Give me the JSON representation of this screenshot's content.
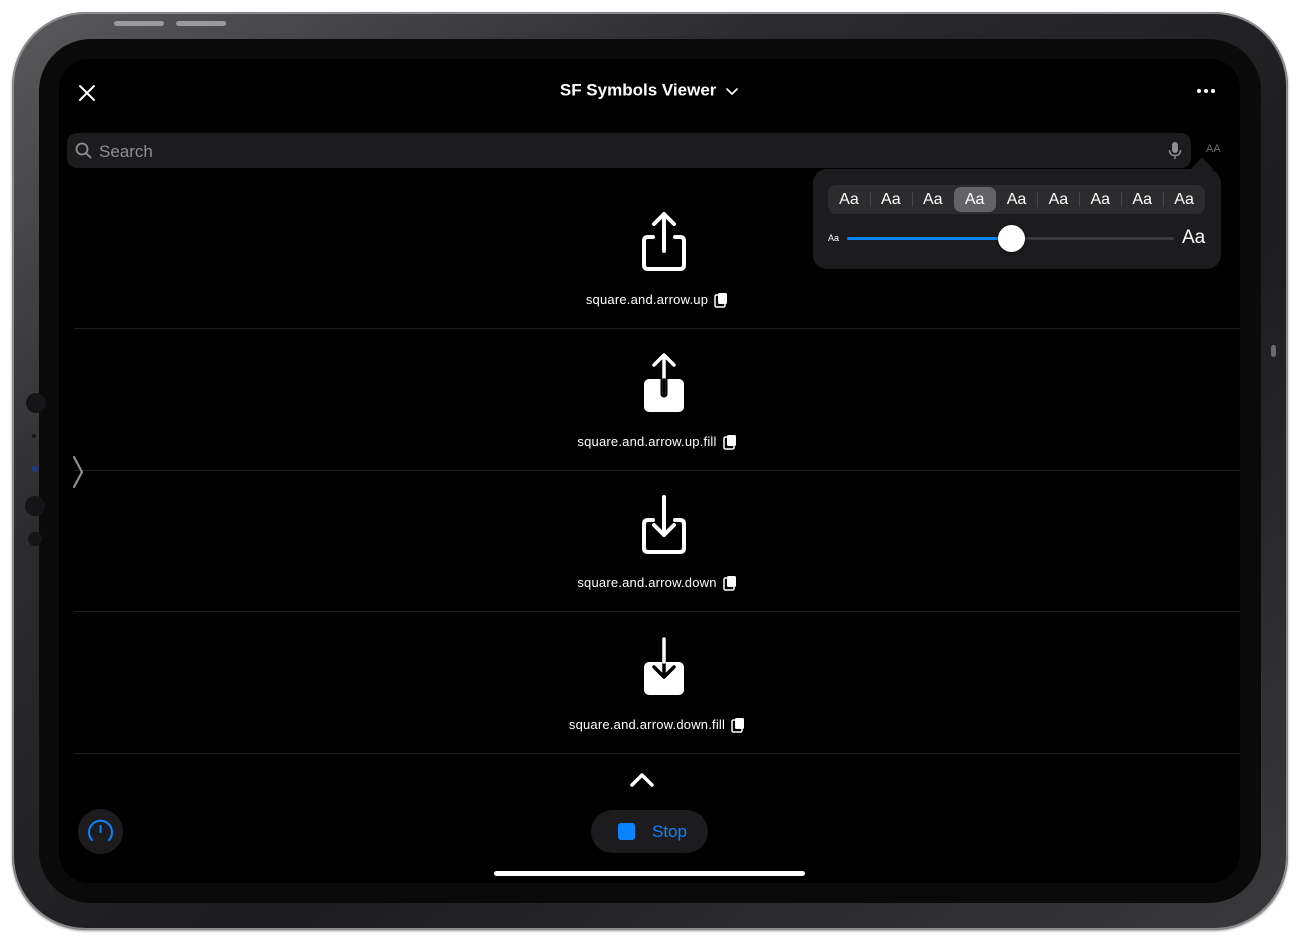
{
  "nav": {
    "title": "SF Symbols Viewer",
    "close_icon": "xmark-icon",
    "more_icon": "ellipsis-icon",
    "title_chevron_icon": "chevron-down-icon"
  },
  "search": {
    "placeholder": "Search",
    "value": "",
    "text_size_label": "AA"
  },
  "text_size_popover": {
    "options": [
      "Aa",
      "Aa",
      "Aa",
      "Aa",
      "Aa",
      "Aa",
      "Aa",
      "Aa",
      "Aa"
    ],
    "selected_index": 3,
    "slider_min_label": "Aa",
    "slider_max_label": "Aa",
    "slider_value": 0.5
  },
  "symbols": [
    {
      "name": "square.and.arrow.up",
      "icon": "square-and-arrow-up-icon"
    },
    {
      "name": "square.and.arrow.up.fill",
      "icon": "square-and-arrow-up-fill-icon"
    },
    {
      "name": "square.and.arrow.down",
      "icon": "square-and-arrow-down-icon"
    },
    {
      "name": "square.and.arrow.down.fill",
      "icon": "square-and-arrow-down-fill-icon"
    }
  ],
  "bottom_bar": {
    "stop_label": "Stop",
    "gauge_icon": "gauge-icon"
  },
  "colors": {
    "accent": "#0a84ff",
    "background": "#000000",
    "surface": "#1c1c1e"
  }
}
